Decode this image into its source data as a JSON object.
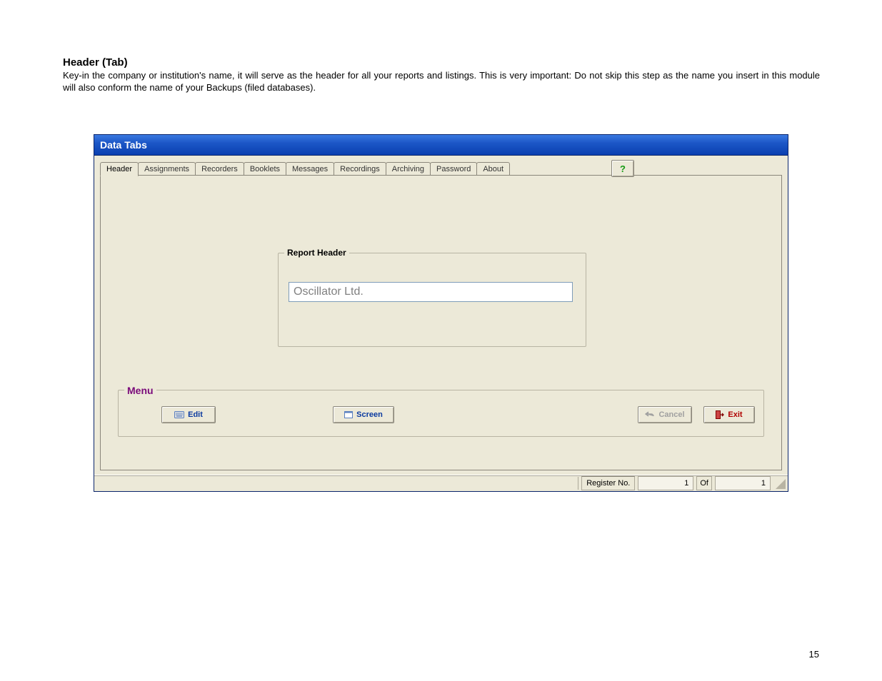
{
  "doc": {
    "heading": "Header (Tab)",
    "paragraph": "Key-in the company or institution's name, it will serve as the header for all your reports and listings. This is very important: Do not skip this step as the name you insert in this module will also conform the name of your Backups (filed databases).",
    "page_number": "15"
  },
  "window": {
    "title": "Data Tabs",
    "help_glyph": "?",
    "tabs": {
      "t0": "Header",
      "t1": "Assignments",
      "t2": "Recorders",
      "t3": "Booklets",
      "t4": "Messages",
      "t5": "Recordings",
      "t6": "Archiving",
      "t7": "Password",
      "t8": "About"
    },
    "report_header": {
      "legend": "Report Header",
      "value": "Oscillator Ltd."
    },
    "menu": {
      "legend": "Menu",
      "edit": "Edit",
      "screen": "Screen",
      "cancel": "Cancel",
      "exit": "Exit"
    },
    "status": {
      "label": "Register No.",
      "current": "1",
      "of": "Of",
      "total": "1"
    }
  }
}
